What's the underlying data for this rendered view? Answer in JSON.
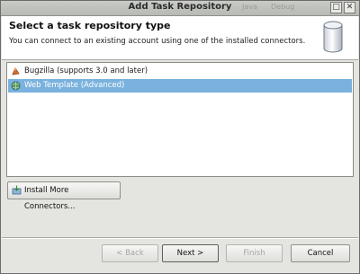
{
  "window": {
    "title": "Add Task Repository",
    "background_hints": [
      "Java",
      "Debug"
    ],
    "controls": {
      "minimize": "□",
      "close": "✕"
    }
  },
  "header": {
    "title": "Select a task repository type",
    "description": "You can connect to an existing account using one of the installed connectors."
  },
  "connectors": [
    {
      "label": "Bugzilla (supports 3.0 and later)",
      "icon": "bugzilla-icon",
      "selected": false
    },
    {
      "label": "Web Template (Advanced)",
      "icon": "web-globe-icon",
      "selected": true
    }
  ],
  "install_button": {
    "label": "Install More Connectors..."
  },
  "buttons": {
    "back": "< Back",
    "next": "Next >",
    "finish": "Finish",
    "cancel": "Cancel"
  },
  "colors": {
    "selection": "#7ab2de",
    "header_bg": "#ffffff",
    "dialog_bg": "#e4e4e0"
  }
}
